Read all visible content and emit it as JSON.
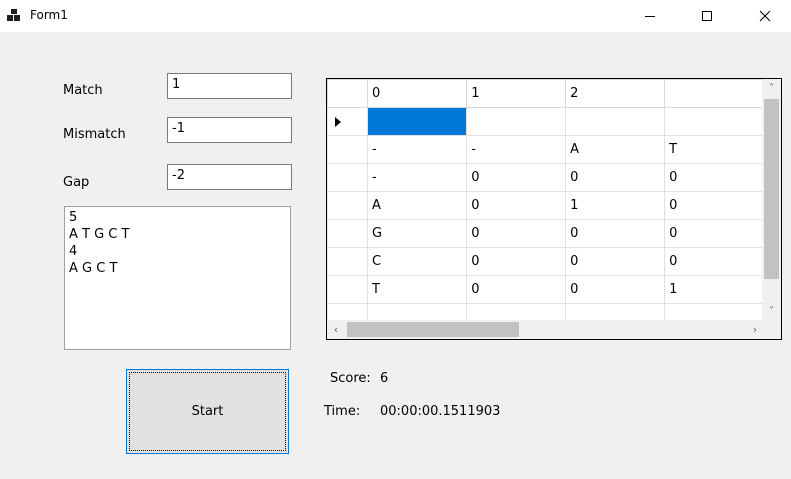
{
  "window": {
    "title": "Form1",
    "icons": {
      "app": "app-icon",
      "minimize": "minimize-icon",
      "maximize": "maximize-icon",
      "close": "close-icon"
    }
  },
  "form": {
    "match_label": "Match",
    "match_value": "1",
    "mismatch_label": "Mismatch",
    "mismatch_value": "-1",
    "gap_label": "Gap",
    "gap_value": "-2",
    "sequences": [
      "5",
      "A T G C T",
      "4",
      "A G C T"
    ],
    "start_label": "Start"
  },
  "grid": {
    "columns": [
      "0",
      "1",
      "2",
      ""
    ],
    "rows": [
      {
        "current": true,
        "cells": [
          "",
          "",
          "",
          ""
        ]
      },
      {
        "current": false,
        "cells": [
          "-",
          "-",
          "A",
          "T"
        ]
      },
      {
        "current": false,
        "cells": [
          "-",
          "0",
          "0",
          "0"
        ]
      },
      {
        "current": false,
        "cells": [
          "A",
          "0",
          "1",
          "0"
        ]
      },
      {
        "current": false,
        "cells": [
          "G",
          "0",
          "0",
          "0"
        ]
      },
      {
        "current": false,
        "cells": [
          "C",
          "0",
          "0",
          "0"
        ]
      },
      {
        "current": false,
        "cells": [
          "T",
          "0",
          "0",
          "1"
        ]
      },
      {
        "current": false,
        "cells": [
          "",
          "",
          "",
          ""
        ]
      }
    ],
    "selected_color": "#0078d7"
  },
  "results": {
    "score_label": "Score:",
    "score_value": "6",
    "time_label": "Time:",
    "time_value": "00:00:00.1511903"
  }
}
